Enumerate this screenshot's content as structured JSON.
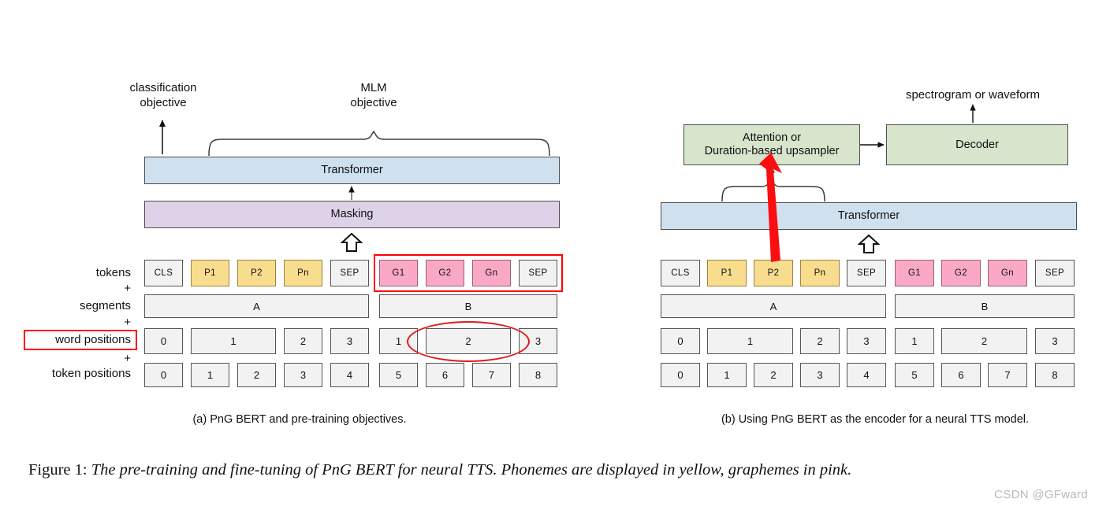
{
  "figure": {
    "caption_label": "Figure 1:",
    "caption_body": "The pre-training and fine-tuning of PnG BERT for neural TTS. Phonemes are displayed in yellow, graphemes in pink.",
    "watermark": "CSDN @GFward"
  },
  "colors": {
    "yellow": "#f8dd8e",
    "pink": "#f9a9c5",
    "blue": "#cfe0ef",
    "lavender": "#ddd2e8",
    "green": "#d6e5cc",
    "grey": "#f2f2f2",
    "annotation_red": "#ff0000"
  },
  "panel_a": {
    "subcaption": "(a) PnG BERT and pre-training objectives.",
    "objective_left": "classification\nobjective",
    "objective_left_line1": "classification",
    "objective_left_line2": "objective",
    "objective_right_line1": "MLM",
    "objective_right_line2": "objective",
    "blocks": {
      "transformer": "Transformer",
      "masking": "Masking"
    },
    "row_labels": {
      "tokens": "tokens",
      "plus1": "+",
      "segments": "segments",
      "plus2": "+",
      "word_positions": "word positions",
      "plus3": "+",
      "token_positions": "token positions"
    },
    "tokens": [
      "CLS",
      "P1",
      "P2",
      "Pn",
      "SEP",
      "G1",
      "G2",
      "Gn",
      "SEP"
    ],
    "token_kinds": [
      "plain",
      "yellow",
      "yellow",
      "yellow",
      "plain",
      "pink",
      "pink",
      "pink",
      "plain"
    ],
    "segments": [
      {
        "label": "A",
        "span": 5
      },
      {
        "label": "B",
        "span": 4
      }
    ],
    "word_positions": [
      {
        "label": "0",
        "span": 1
      },
      {
        "label": "1",
        "span": 2
      },
      {
        "label": "2",
        "span": 1
      },
      {
        "label": "3",
        "span": 1
      },
      {
        "label": "1",
        "span": 1
      },
      {
        "label": "2",
        "span": 2
      },
      {
        "label": "3",
        "span": 1
      }
    ],
    "token_positions": [
      "0",
      "1",
      "2",
      "3",
      "4",
      "5",
      "6",
      "7",
      "8"
    ],
    "annotations": {
      "grapheme_group_highlight": "red rectangle around G1 G2 Gn SEP tokens",
      "word_positions_label_highlight": "red rectangle around word positions label",
      "word_position_ellipse": "red ellipse around word position 2 of segment B"
    }
  },
  "panel_b": {
    "subcaption": "(b) Using PnG BERT as the encoder for a neural TTS model.",
    "output_label": "spectrogram or waveform",
    "blocks": {
      "upsampler_line1": "Attention or",
      "upsampler_line2": "Duration-based upsampler",
      "decoder": "Decoder",
      "transformer": "Transformer"
    },
    "tokens": [
      "CLS",
      "P1",
      "P2",
      "Pn",
      "SEP",
      "G1",
      "G2",
      "Gn",
      "SEP"
    ],
    "token_kinds": [
      "plain",
      "yellow",
      "yellow",
      "yellow",
      "plain",
      "pink",
      "pink",
      "pink",
      "plain"
    ],
    "segments": [
      {
        "label": "A",
        "span": 5
      },
      {
        "label": "B",
        "span": 4
      }
    ],
    "word_positions": [
      {
        "label": "0",
        "span": 1
      },
      {
        "label": "1",
        "span": 2
      },
      {
        "label": "2",
        "span": 1
      },
      {
        "label": "3",
        "span": 1
      },
      {
        "label": "1",
        "span": 1
      },
      {
        "label": "2",
        "span": 2
      },
      {
        "label": "3",
        "span": 1
      }
    ],
    "token_positions": [
      "0",
      "1",
      "2",
      "3",
      "4",
      "5",
      "6",
      "7",
      "8"
    ],
    "annotations": {
      "red_arrow": "thick red arrow from P2 token up into the upsampler"
    }
  }
}
